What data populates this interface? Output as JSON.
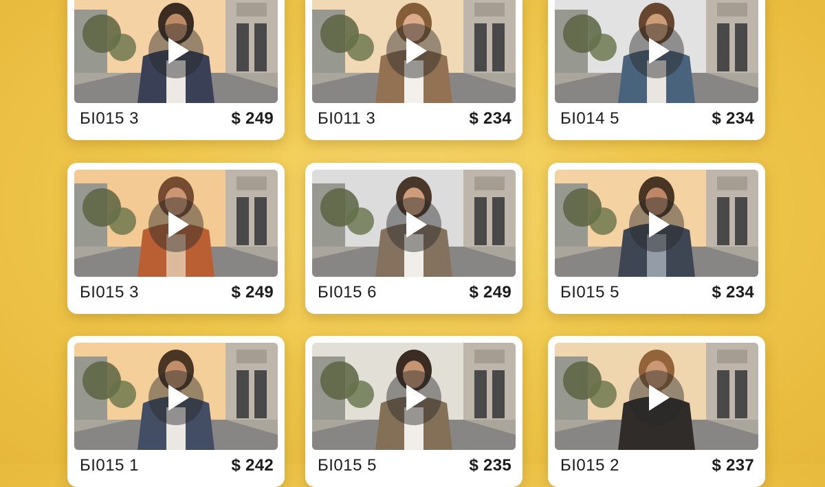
{
  "products": [
    {
      "sku": "БI015 3",
      "price": "$ 249",
      "sky": "#f4d2a4",
      "coat": "#2a3550",
      "shirt": "#ececec",
      "hair": "#2b1e16",
      "skin": "#b88560"
    },
    {
      "sku": "БI011 3",
      "price": "$ 234",
      "sky": "#f1d9b8",
      "coat": "#8a6a4c",
      "shirt": "#f2f2f2",
      "hair": "#7a5330",
      "skin": "#d9a98a"
    },
    {
      "sku": "БI014 5",
      "price": "$ 234",
      "sky": "#dfe3e6",
      "coat": "#3a5a7a",
      "shirt": "#e8e8e8",
      "hair": "#5a3a24",
      "skin": "#c99873"
    },
    {
      "sku": "БI015 3",
      "price": "$ 249",
      "sky": "#f2c992",
      "coat": "#b4552a",
      "shirt": "#d9b89a",
      "hair": "#6b4028",
      "skin": "#c89070"
    },
    {
      "sku": "БI015 6",
      "price": "$ 249",
      "sky": "#d8dde0",
      "coat": "#7a6a58",
      "shirt": "#f0f0f0",
      "hair": "#3a2a20",
      "skin": "#c99878"
    },
    {
      "sku": "БI015 5",
      "price": "$ 234",
      "sky": "#f3d2a2",
      "coat": "#2e3a4e",
      "shirt": "#8a97a8",
      "hair": "#3a2818",
      "skin": "#b98262"
    },
    {
      "sku": "БI015 1",
      "price": "$ 242",
      "sky": "#f4cf98",
      "coat": "#33425e",
      "shirt": "#eaeaea",
      "hair": "#3a2818",
      "skin": "#bb8864"
    },
    {
      "sku": "БI015 5",
      "price": "$ 235",
      "sky": "#e0e0dc",
      "coat": "#7a6850",
      "shirt": "#f0f0f0",
      "hair": "#2a1e18",
      "skin": "#c09070"
    },
    {
      "sku": "БI015 2",
      "price": "$ 237",
      "sky": "#efd6b0",
      "coat": "#1e1e20",
      "shirt": "#1e1e20",
      "hair": "#8a5a30",
      "skin": "#c89270"
    }
  ],
  "icons": {
    "play": "play-icon"
  }
}
